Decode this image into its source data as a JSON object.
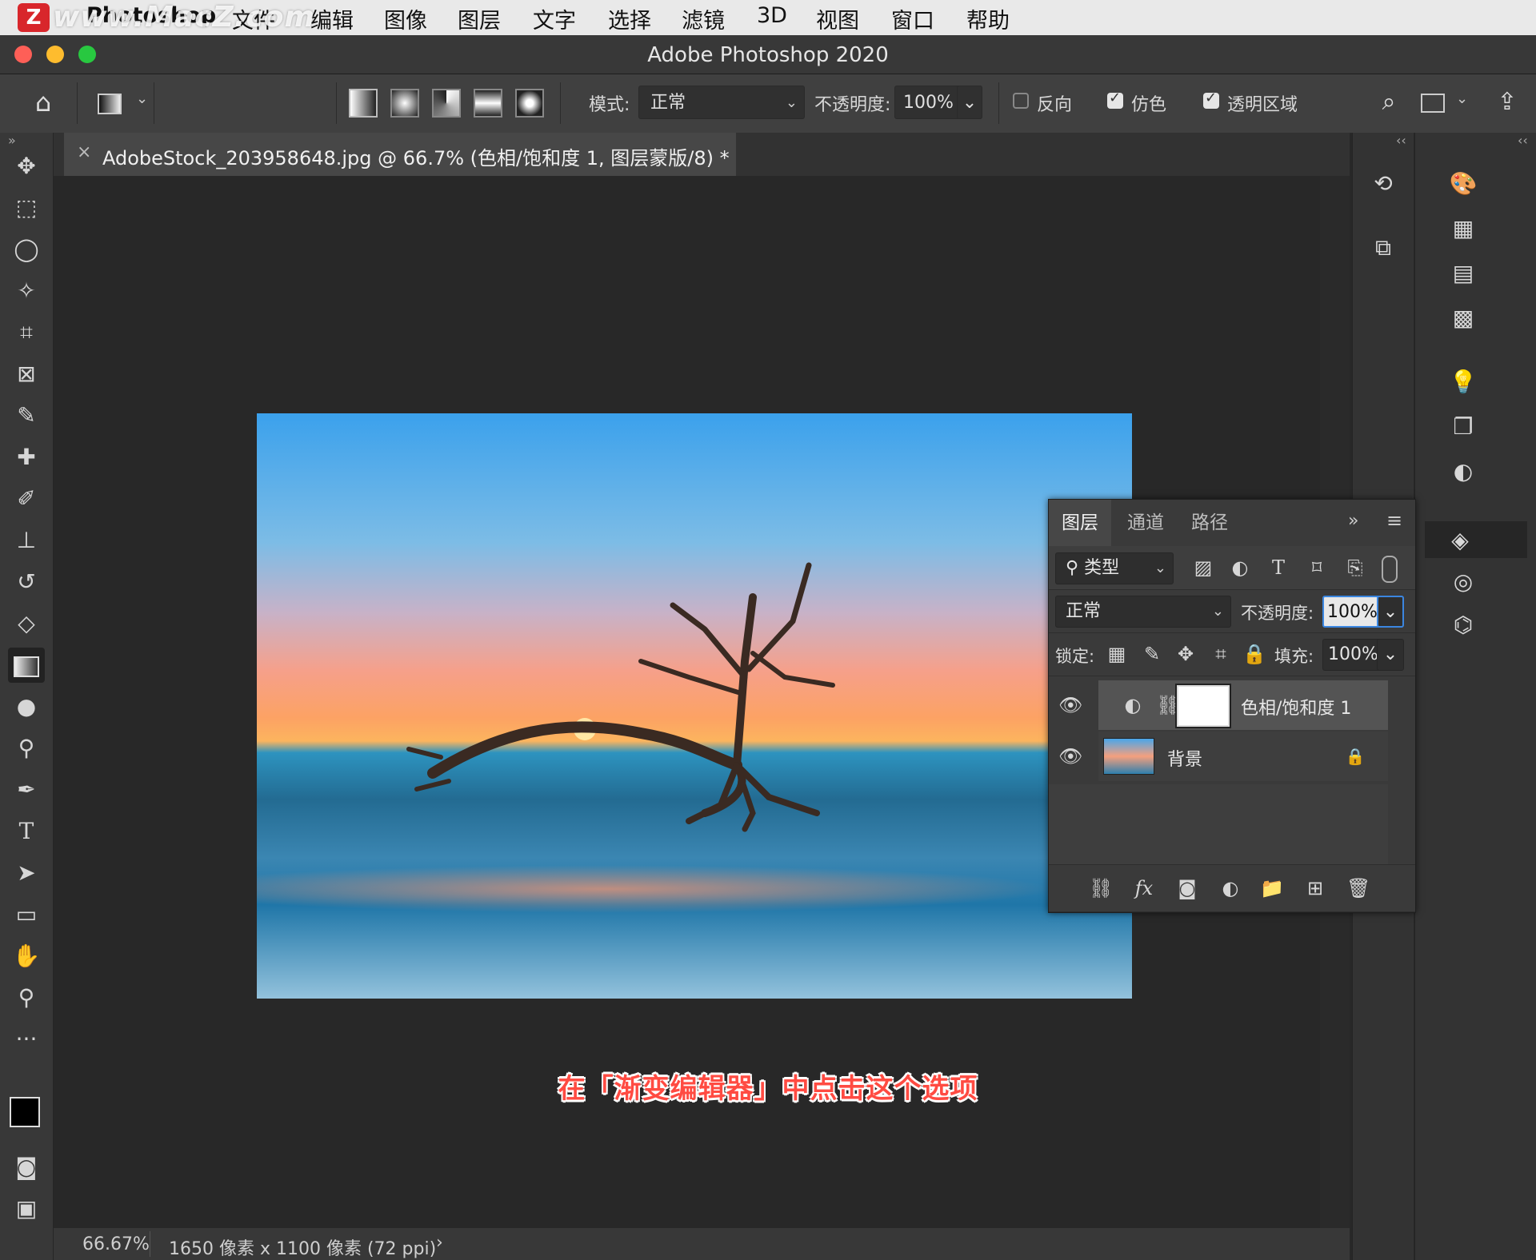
{
  "menubar": {
    "app": "Photoshop",
    "items": [
      "文件",
      "编辑",
      "图像",
      "图层",
      "文字",
      "选择",
      "滤镜",
      "3D",
      "视图",
      "窗口",
      "帮助"
    ],
    "watermark": "www.MacZ.com",
    "logo": "Z"
  },
  "window": {
    "title": "Adobe Photoshop 2020"
  },
  "options": {
    "mode_label": "模式:",
    "mode_value": "正常",
    "opacity_label": "不透明度:",
    "opacity_value": "100%",
    "reverse_label": "反向",
    "dither_label": "仿色",
    "transparency_label": "透明区域",
    "reverse_checked": false,
    "dither_checked": true,
    "transparency_checked": true,
    "highlight_color": "#e8302c"
  },
  "document": {
    "tab_title": "AdobeStock_203958648.jpg @ 66.7% (色相/饱和度 1, 图层蒙版/8) *",
    "caption": "在「渐变编辑器」中点击这个选项"
  },
  "status": {
    "zoom": "66.67%",
    "info": "1650 像素 x 1100 像素 (72 ppi)"
  },
  "layers_panel": {
    "tabs": [
      "图层",
      "通道",
      "路径"
    ],
    "filter_label": "类型",
    "blend_mode": "正常",
    "opacity_label": "不透明度:",
    "opacity_value": "100%",
    "lock_label": "锁定:",
    "fill_label": "填充:",
    "fill_value": "100%",
    "layers": [
      {
        "name": "色相/饱和度 1"
      },
      {
        "name": "背景"
      }
    ]
  },
  "icons": {
    "home": "home-icon",
    "move": "move-tool-icon",
    "marquee": "marquee-tool-icon",
    "lasso": "lasso-tool-icon",
    "wand": "magic-wand-icon",
    "crop": "crop-tool-icon",
    "gradient": "gradient-tool-icon",
    "text": "type-tool-icon",
    "zoom": "zoom-tool-icon"
  }
}
